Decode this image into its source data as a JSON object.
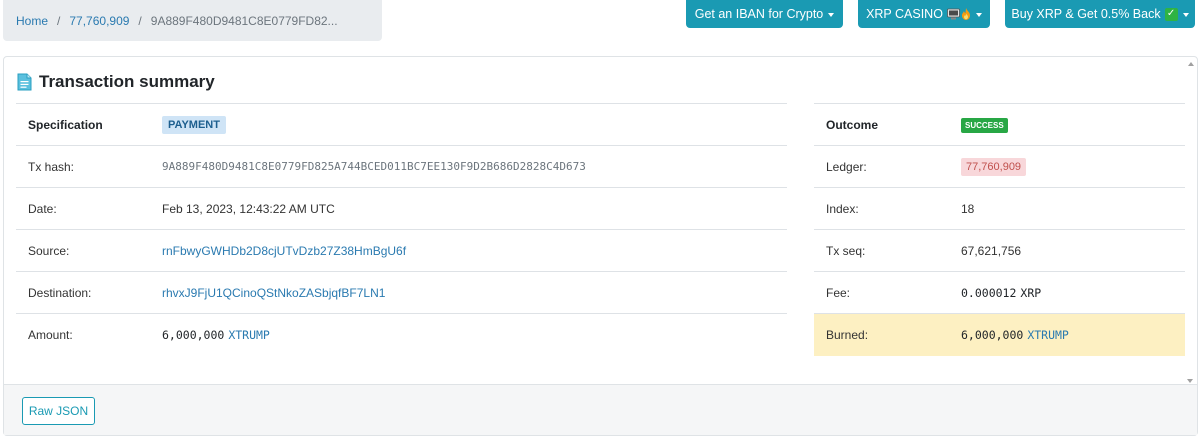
{
  "breadcrumb": {
    "home": "Home",
    "sep1": "/",
    "ledger": "77,760,909",
    "sep2": "/",
    "current": "9A889F480D9481C8E0779FD82..."
  },
  "top_buttons": {
    "iban": "Get an IBAN for Crypto",
    "casino": "XRP CASINO",
    "buy_xrp": "Buy XRP & Get 0.5% Back"
  },
  "card": {
    "title": "Transaction summary"
  },
  "left_rows": {
    "specification_label": "Specification",
    "specification_value": "PAYMENT",
    "txhash_label": "Tx hash:",
    "txhash_value": "9A889F480D9481C8E0779FD825A744BCED011BC7EE130F9D2B686D2828C4D673",
    "date_label": "Date:",
    "date_value": "Feb 13, 2023, 12:43:22 AM UTC",
    "source_label": "Source:",
    "source_value": "rnFbwyGWHDb2D8cjUTvDzb27Z38HmBgU6f",
    "destination_label": "Destination:",
    "destination_value": "rhvxJ9FjU1QCinoQStNkoZASbjqfBF7LN1",
    "amount_label": "Amount:",
    "amount_number": "6,000,000",
    "amount_currency": "XTRUMP"
  },
  "right_rows": {
    "outcome_label": "Outcome",
    "outcome_value": "SUCCESS",
    "ledger_label": "Ledger:",
    "ledger_value": "77,760,909",
    "index_label": "Index:",
    "index_value": "18",
    "txseq_label": "Tx seq:",
    "txseq_value": "67,621,756",
    "fee_label": "Fee:",
    "fee_number": "0.000012",
    "fee_currency": "XRP",
    "burned_label": "Burned:",
    "burned_number": "6,000,000",
    "burned_currency": "XTRUMP"
  },
  "footer": {
    "raw_json": "Raw JSON"
  },
  "colors": {
    "accent": "#1a9ab3",
    "link": "#2a7ab0",
    "success": "#28a745",
    "burned_bg": "#fdf0c2"
  },
  "icons": {
    "title_icon": "document-icon",
    "casino_icon": "monitor-flame-emoji",
    "buy_icon": "check-mark-emoji"
  }
}
